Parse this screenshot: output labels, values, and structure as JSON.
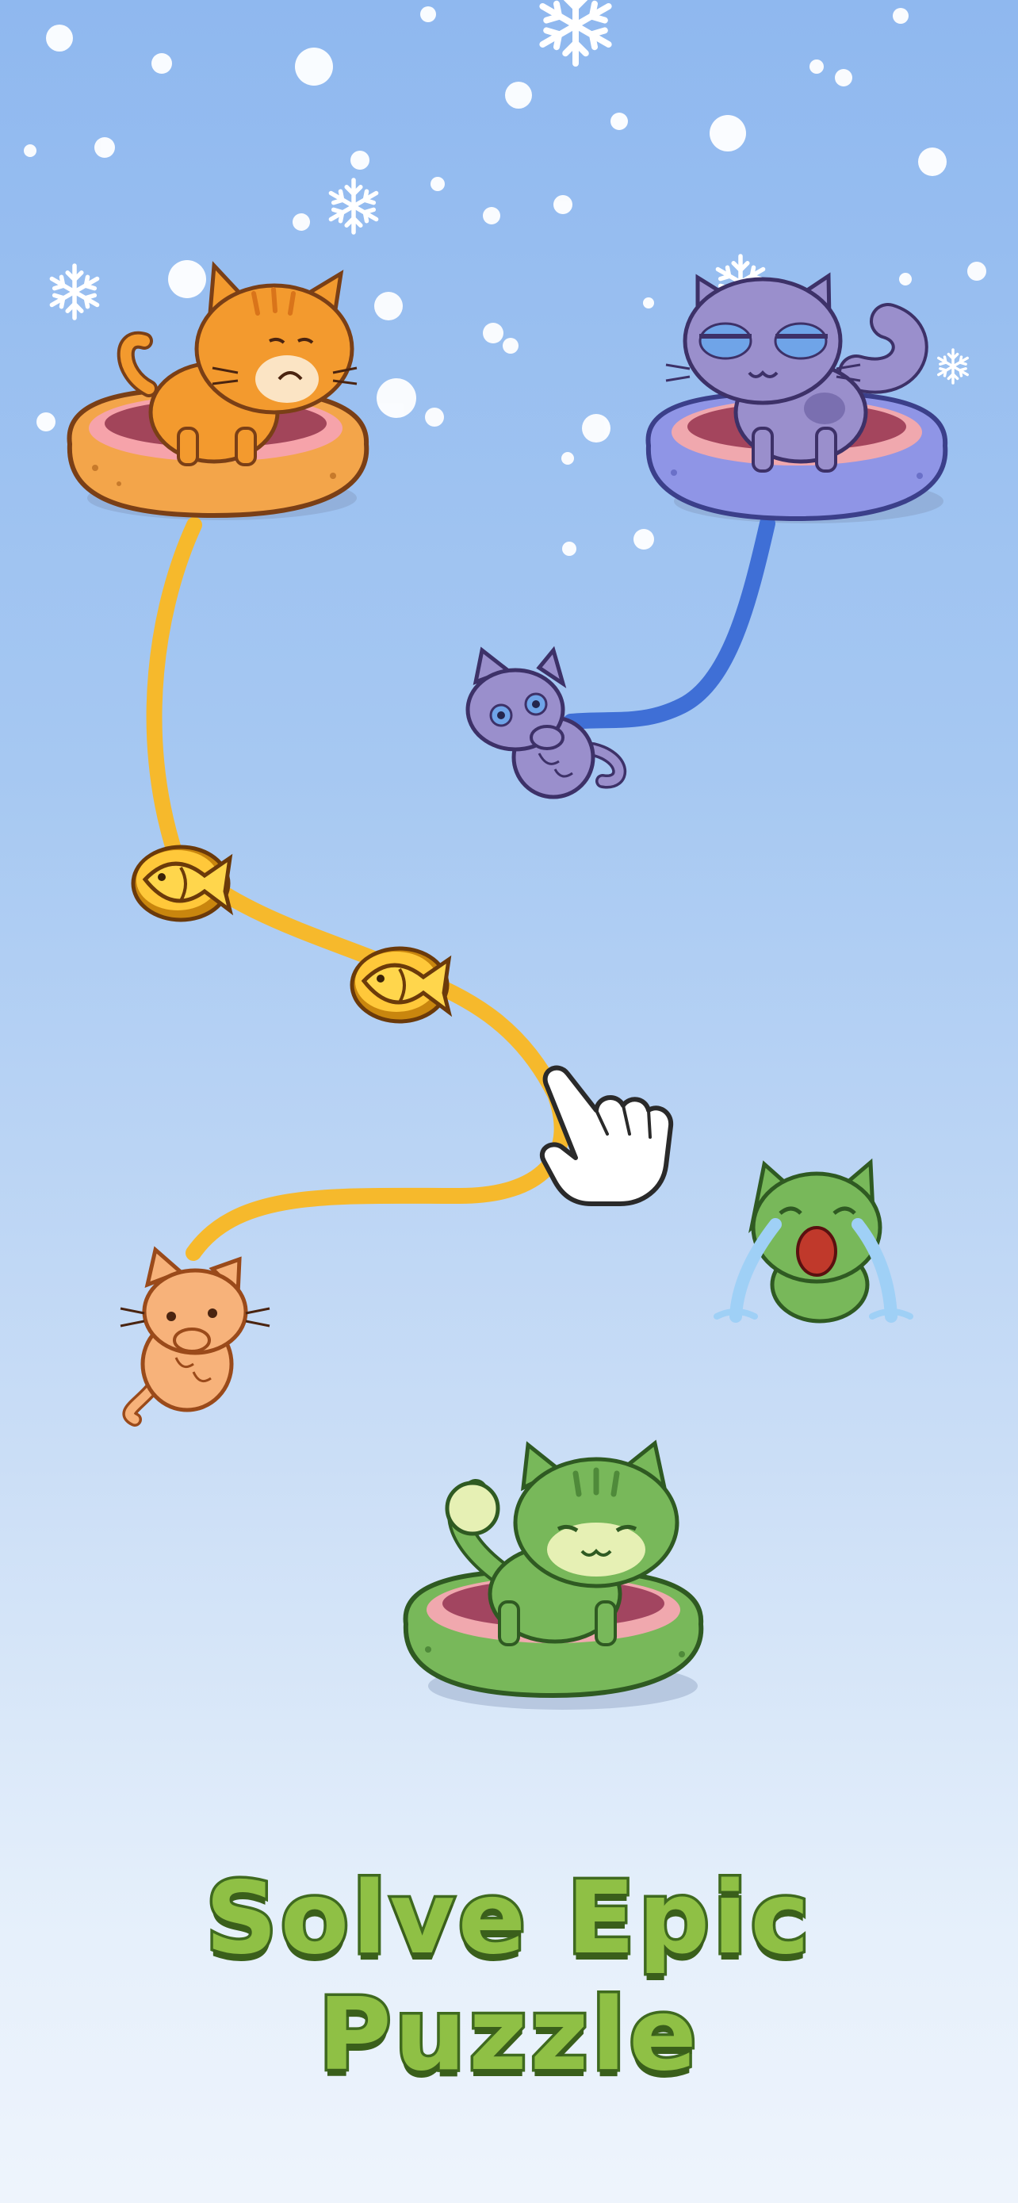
{
  "screen": {
    "caption": "Solve Epic Puzzle"
  },
  "colors": {
    "background_top": "#8fb8ef",
    "background_bottom": "#eef4fc",
    "orange_path": "#f6b92c",
    "blue_path": "#3f6fd6",
    "caption_fill": "#8fc045",
    "caption_stroke": "#3f6a1f"
  },
  "game": {
    "beds": [
      {
        "color": "orange",
        "cat_mood": "grumpy"
      },
      {
        "color": "purple",
        "cat_mood": "sleepy"
      },
      {
        "color": "green",
        "cat_mood": "content"
      }
    ],
    "kittens": [
      {
        "color": "purple",
        "mood": "shy"
      },
      {
        "color": "orange",
        "mood": "shy"
      },
      {
        "color": "green",
        "mood": "crying"
      }
    ],
    "collectibles": [
      {
        "type": "goldfish-coin"
      },
      {
        "type": "goldfish-coin"
      }
    ],
    "hint": {
      "type": "tap-hand"
    }
  }
}
